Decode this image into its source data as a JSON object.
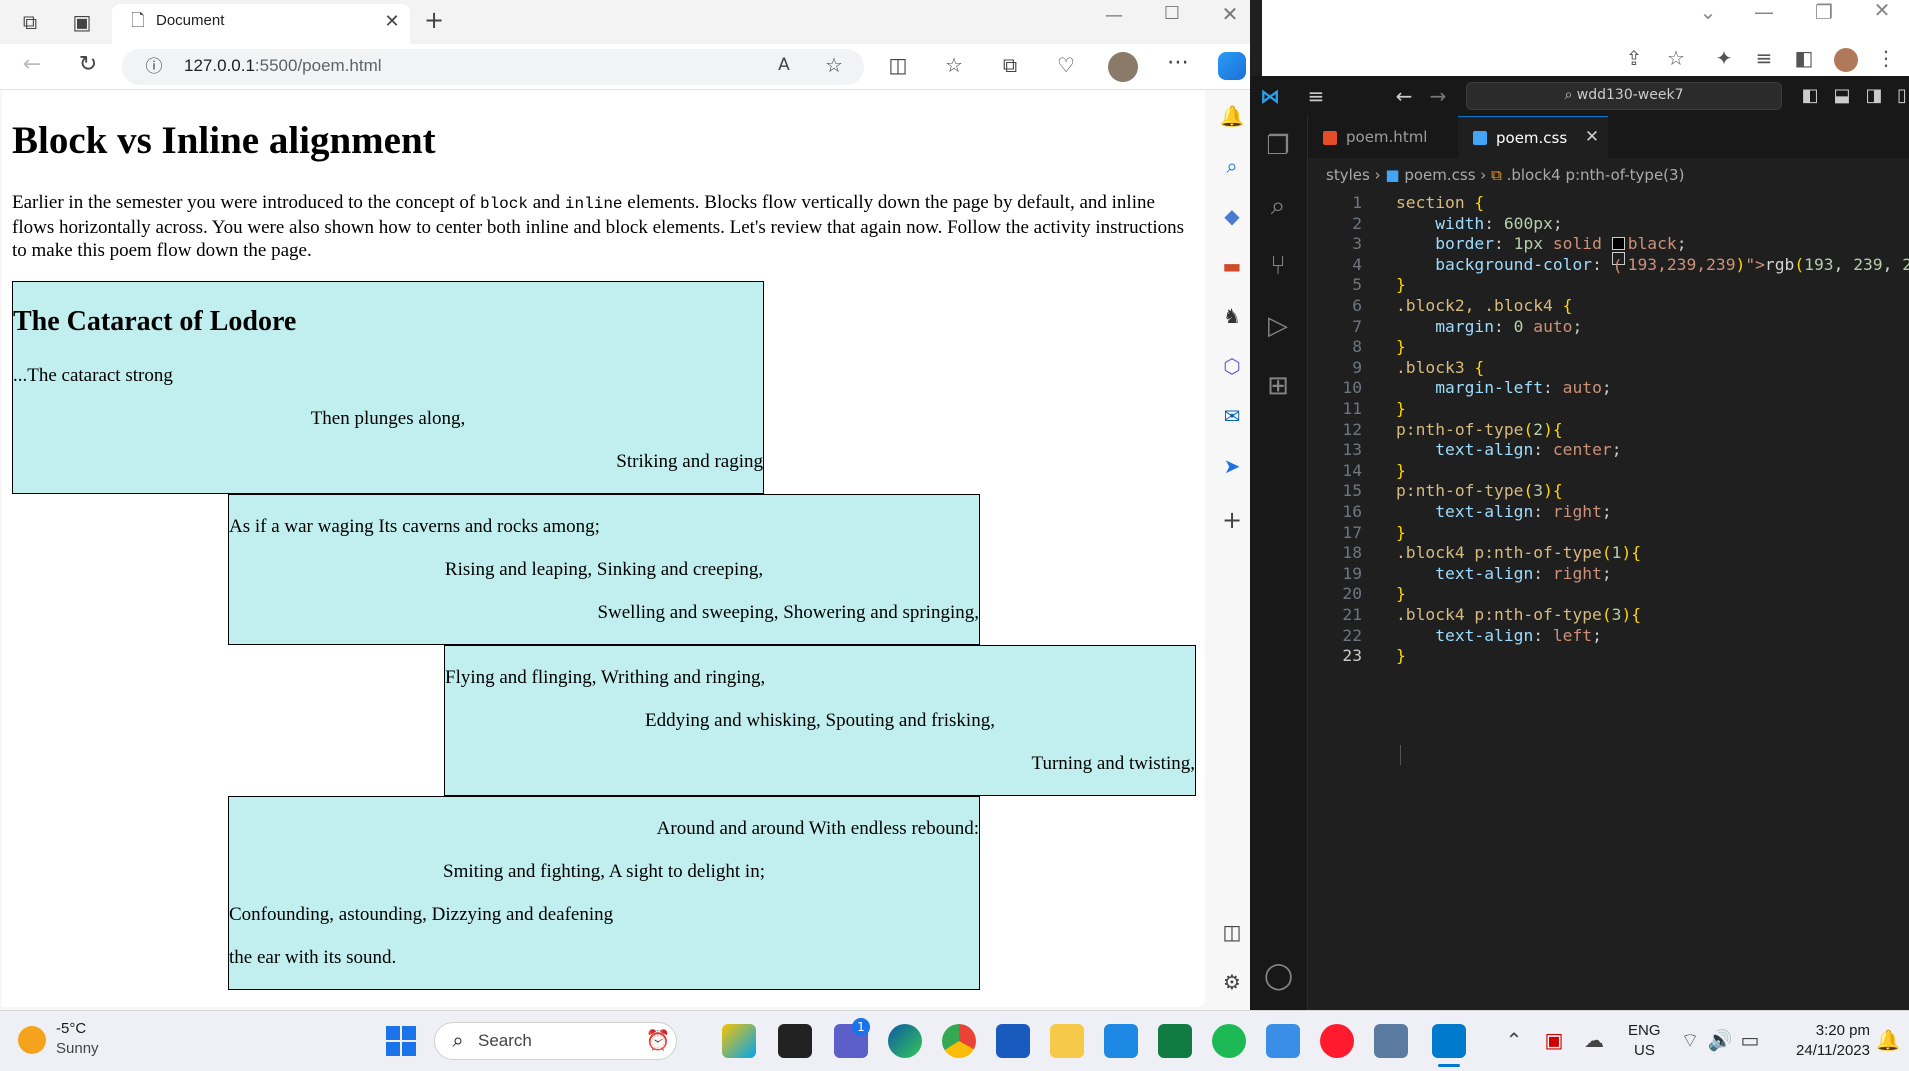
{
  "browser": {
    "tab_title": "Document",
    "url_host": "127.0.0.1",
    "url_path": ":5500/poem.html"
  },
  "page": {
    "title": "Block vs Inline alignment",
    "intro_part1": "Earlier in the semester you were introduced to the concept of ",
    "intro_code1": "block",
    "intro_mid": " and ",
    "intro_code2": "inline",
    "intro_part2": " elements. Blocks flow vertically down the page by default, and inline flows horizontally across. You were also shown how to center both inline and block elements. Let's review that again now. Follow the activity instructions to make this poem flow down the page.",
    "poem_title": "The Cataract of Lodore",
    "block1": [
      "...The cataract strong",
      "Then plunges along,",
      "Striking and raging"
    ],
    "block2": [
      "As if a war waging Its caverns and rocks among;",
      "Rising and leaping, Sinking and creeping,",
      "Swelling and sweeping, Showering and springing,"
    ],
    "block3": [
      "Flying and flinging, Writhing and ringing,",
      "Eddying and whisking, Spouting and frisking,",
      "Turning and twisting,"
    ],
    "block4": [
      "Around and around With endless rebound:",
      "Smiting and fighting, A sight to delight in;",
      "Confounding, astounding, Dizzying and deafening",
      "the ear with its sound."
    ]
  },
  "vscode": {
    "command_center": "wdd130-week7",
    "tabs": [
      {
        "label": "poem.html",
        "active": false
      },
      {
        "label": "poem.css",
        "active": true
      }
    ],
    "breadcrumb": {
      "folder": "styles",
      "file": "poem.css",
      "symbol": ".block4 p:nth-of-type(3)"
    },
    "current_line": 23,
    "code_lines": [
      "section {",
      "    width: 600px;",
      "    border: 1px solid black;",
      "    background-color: rgb(193, 239, 239);",
      "}",
      ".block2, .block4 {",
      "    margin: 0 auto;",
      "}",
      ".block3 {",
      "    margin-left: auto;",
      "}",
      "p:nth-of-type(2){",
      "    text-align: center;",
      "}",
      "p:nth-of-type(3){",
      "    text-align: right;",
      "}",
      ".block4 p:nth-of-type(1){",
      "    text-align: right;",
      "}",
      ".block4 p:nth-of-type(3){",
      "    text-align: left;",
      "}"
    ]
  },
  "taskbar": {
    "weather_temp": "-5°C",
    "weather_desc": "Sunny",
    "search_label": "Search",
    "lang_top": "ENG",
    "lang_bottom": "US",
    "time": "3:20 pm",
    "date": "24/11/2023",
    "chat_badge": "1"
  },
  "colors": {
    "section_bg": "#c1efef",
    "vscode_bg": "#1f1f1f",
    "accent": "#0078d4"
  }
}
